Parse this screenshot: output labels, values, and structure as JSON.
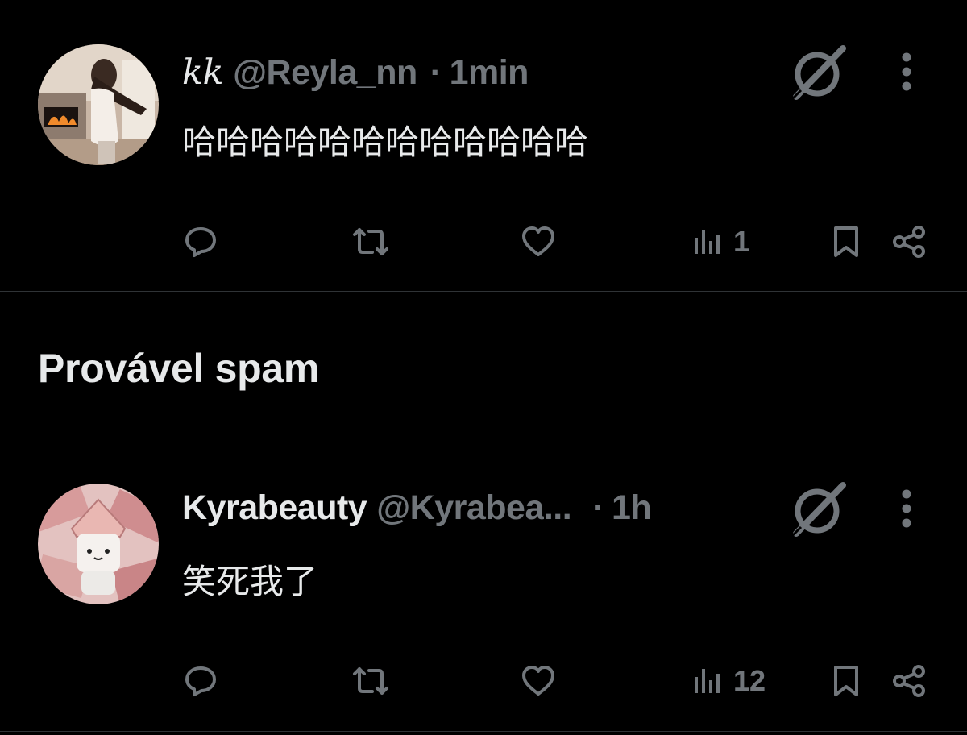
{
  "posts": [
    {
      "name": "kk",
      "handle": "@Reyla_nn",
      "separator": "·",
      "time": "1min",
      "text": "哈哈哈哈哈哈哈哈哈哈哈哈",
      "views": "1"
    },
    {
      "name": "Kyrabeauty",
      "handle": "@Kyrabea",
      "handle_ellipsis": "...",
      "separator": "·",
      "time": "1h",
      "text": "笑死我了",
      "views": "12"
    }
  ],
  "section": {
    "title": "Provável spam"
  },
  "icons": {
    "reply": "reply-icon",
    "repost": "repost-icon",
    "like": "heart-icon",
    "views": "views-icon",
    "bookmark": "bookmark-icon",
    "share": "share-icon",
    "grok": "grok-icon",
    "more": "more-options-icon"
  },
  "colors": {
    "background": "#000000",
    "text": "#e7e9ea",
    "muted": "#71767b",
    "divider": "#2f3336"
  }
}
